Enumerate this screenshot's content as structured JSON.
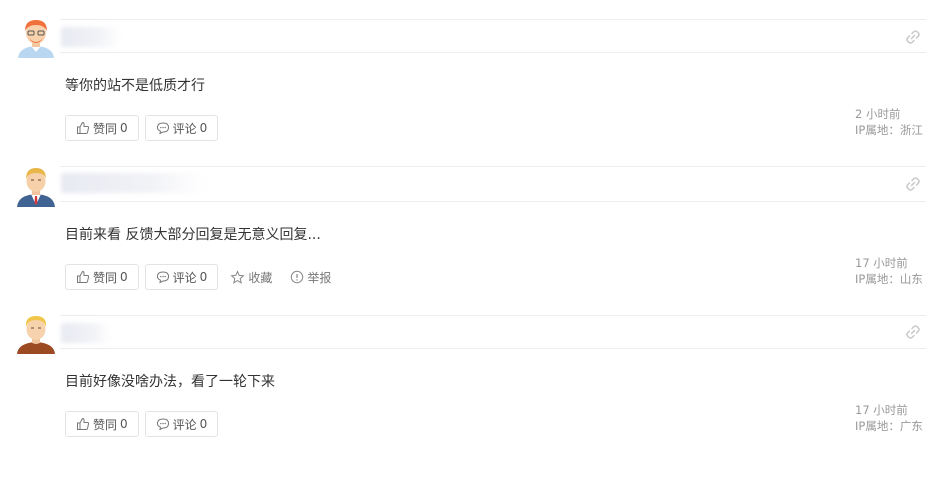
{
  "comments": [
    {
      "content": "等你的站不是低质才行",
      "like_label": "赞同",
      "like_count": "0",
      "comment_label": "评论",
      "comment_count": "0",
      "time": "2 小时前",
      "ip": "IP属地：浙江",
      "avatar_icon": "male-avatar-red-hair-icon"
    },
    {
      "content": "目前来看 反馈大部分回复是无意义回复...",
      "like_label": "赞同",
      "like_count": "0",
      "comment_label": "评论",
      "comment_count": "0",
      "favorite_label": "收藏",
      "report_label": "举报",
      "time": "17 小时前",
      "ip": "IP属地：山东",
      "avatar_icon": "male-avatar-suit-icon"
    },
    {
      "content": "目前好像没啥办法，看了一轮下来",
      "like_label": "赞同",
      "like_count": "0",
      "comment_label": "评论",
      "comment_count": "0",
      "time": "17 小时前",
      "ip": "IP属地：广东",
      "avatar_icon": "male-avatar-blond-icon"
    }
  ],
  "colors": {
    "divider": "#ededed",
    "border": "#e3e3e3",
    "meta_text": "#999999",
    "body_text": "#333333"
  }
}
